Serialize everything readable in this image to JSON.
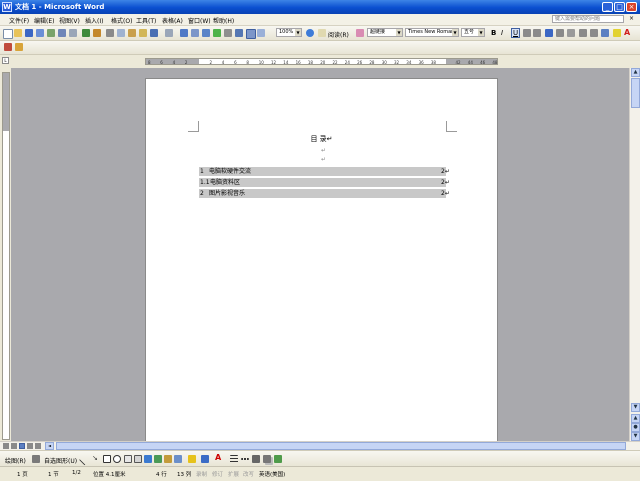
{
  "window": {
    "title": "文档 1 - Microsoft Word"
  },
  "menu": {
    "items": [
      "文件(F)",
      "编辑(E)",
      "视图(V)",
      "插入(I)",
      "格式(O)",
      "工具(T)",
      "表格(A)",
      "窗口(W)",
      "帮助(H)"
    ],
    "help_placeholder": "键入需要帮助的问题"
  },
  "toolbar": {
    "zoom": "100%",
    "reading_label": "阅读(R)",
    "style": "超链接",
    "font": "Times New Roman",
    "size": "五号",
    "bold": "B",
    "italic": "I",
    "underline": "U",
    "font_color_glyph": "A"
  },
  "ruler": {
    "ticks": [
      "8",
      "6",
      "4",
      "2",
      "",
      "2",
      "4",
      "6",
      "8",
      "10",
      "12",
      "14",
      "16",
      "18",
      "20",
      "22",
      "24",
      "26",
      "28",
      "30",
      "32",
      "34",
      "36",
      "38",
      "",
      "42",
      "44",
      "46",
      "48"
    ]
  },
  "document": {
    "toc_title": "目  录↵",
    "toc": [
      {
        "num": "1",
        "text": "电脑软硬件交流",
        "page": "2↵"
      },
      {
        "num": "1.1",
        "text": "电脑资料区",
        "page": "2↵"
      },
      {
        "num": "2",
        "text": "图片影视音乐",
        "page": "2↵"
      }
    ]
  },
  "drawing_toolbar": {
    "draw_label": "绘图(R)",
    "autoshape_label": "自选图形(U)"
  },
  "status": {
    "page": "1 页",
    "section": "1 节",
    "page_of": "1/2",
    "position": "位置 4.1厘米",
    "line": "4 行",
    "column": "13 列",
    "rec": "录制",
    "trk": "修订",
    "ext": "扩展",
    "ovr": "改写",
    "language": "英语(美国)"
  },
  "colors": {
    "titlebar": "#0a4fd0",
    "toc_highlight": "#c8c8c8",
    "doc_background": "#a9a9ad"
  }
}
